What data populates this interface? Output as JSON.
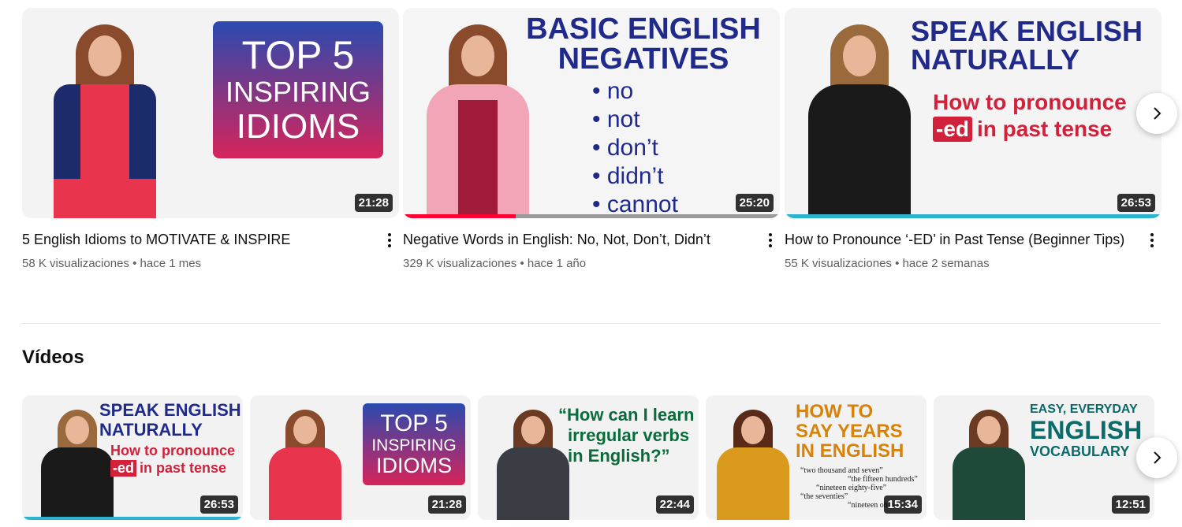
{
  "shelf": {
    "cards": [
      {
        "title": "5 English Idioms to MOTIVATE & INSPIRE",
        "views": "58 K visualizaciones",
        "age": "hace 1 mes",
        "duration": "21:28",
        "thumb_lines": [
          "TOP 5",
          "INSPIRING",
          "IDIOMS"
        ],
        "watched_fraction": 0
      },
      {
        "title": "Negative Words in English: No, Not, Don’t, Didn’t",
        "views": "329 K visualizaciones",
        "age": "hace 1 año",
        "duration": "25:20",
        "thumb_heading": [
          "BASIC ENGLISH",
          "NEGATIVES"
        ],
        "thumb_bullets": [
          "• no",
          "• not",
          "• don’t",
          "• didn’t",
          "• cannot"
        ],
        "watched_fraction": 0.3
      },
      {
        "title": "How to Pronounce ‘-ED’ in Past Tense (Beginner Tips)",
        "views": "55 K visualizaciones",
        "age": "hace 2 semanas",
        "duration": "26:53",
        "thumb_heading": [
          "SPEAK ENGLISH",
          "NATURALLY"
        ],
        "thumb_sub1": "How to pronounce",
        "thumb_ed": "-ed",
        "thumb_sub2": "in past tense",
        "watched_fraction": 1.0
      }
    ]
  },
  "videos_section": {
    "title": "Vídeos",
    "cards": [
      {
        "duration": "26:53",
        "lines": [
          "SPEAK ENGLISH",
          "NATURALLY"
        ],
        "sub1": "How to pronounce",
        "ed": "-ed",
        "sub2": "in past tense"
      },
      {
        "duration": "21:28",
        "lines": [
          "TOP 5",
          "INSPIRING",
          "IDIOMS"
        ]
      },
      {
        "duration": "22:44",
        "lines": [
          "“How can I learn",
          "irregular verbs",
          "in English?”"
        ]
      },
      {
        "duration": "15:34",
        "lines": [
          "HOW TO",
          "SAY YEARS",
          "IN ENGLISH"
        ],
        "quotes": [
          "“two thousand and seven”",
          "“the fifteen hundreds”",
          "“nineteen eighty-five”",
          "“the seventies”",
          "“nineteen oh two”"
        ]
      },
      {
        "duration": "12:51",
        "lines": [
          "EASY, EVERYDAY",
          "ENGLISH",
          "VOCABULARY"
        ]
      }
    ]
  },
  "colors": {
    "progress_red": "#ff0033",
    "progress_teal": "#2bb3d0",
    "idioms_box_top": "#2a4ab0",
    "idioms_box_bottom": "#d6245a",
    "navy_text": "#1f2a8a",
    "red_text": "#d1213b",
    "green_text": "#0a6b3a",
    "orange_text": "#d7830a",
    "teal_text": "#0a6b6b"
  }
}
